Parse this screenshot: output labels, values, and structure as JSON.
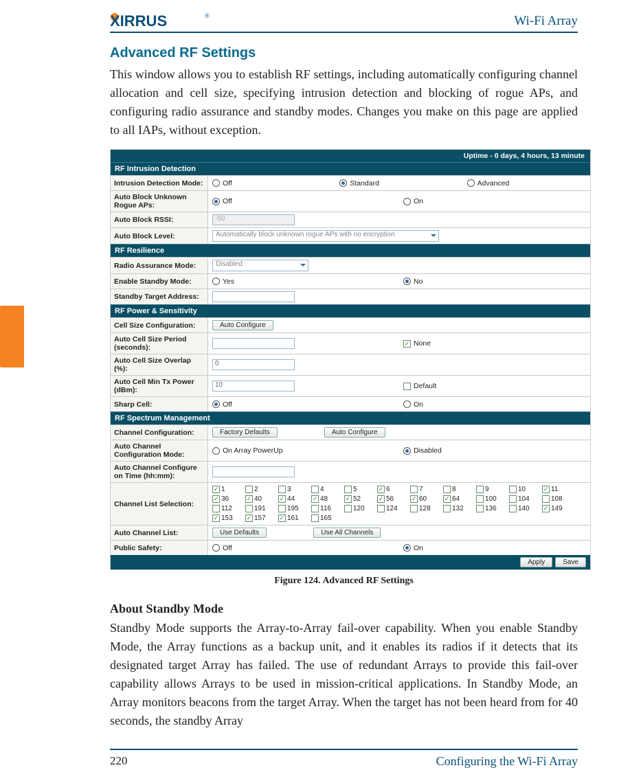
{
  "header": {
    "product": "Wi-Fi Array",
    "logo_text": "XIRRUS"
  },
  "section": {
    "title": "Advanced RF Settings",
    "intro": "This window allows you to establish RF settings, including automatically configuring channel allocation and cell size, specifying intrusion detection and blocking of rogue APs, and configuring radio assurance and standby modes. Changes you make on this page are applied to all IAPs, without exception."
  },
  "screenshot": {
    "uptime": "Uptime - 0 days, 4 hours, 13 minute",
    "groups": {
      "intrusion": "RF Intrusion Detection",
      "resilience": "RF Resilience",
      "power": "RF Power & Sensitivity",
      "spectrum": "RF Spectrum Management"
    },
    "rows": {
      "idm": {
        "label": "Intrusion Detection Mode:",
        "opts": [
          "Off",
          "Standard",
          "Advanced"
        ],
        "sel": "Standard"
      },
      "abu": {
        "label": "Auto Block Unknown Rogue APs:",
        "opts": [
          "Off",
          "On"
        ],
        "sel": "Off"
      },
      "abr": {
        "label": "Auto Block RSSI:",
        "value": "-50"
      },
      "abl": {
        "label": "Auto Block Level:",
        "value": "Automatically block unknown rogue APs with no encryption"
      },
      "ram": {
        "label": "Radio Assurance Mode:",
        "value": "Disabled"
      },
      "esm": {
        "label": "Enable Standby Mode:",
        "opts": [
          "Yes",
          "No"
        ],
        "sel": "No"
      },
      "sta": {
        "label": "Standby Target Address:",
        "value": ""
      },
      "csc": {
        "label": "Cell Size Configuration:",
        "btn": "Auto Configure"
      },
      "acsp": {
        "label": "Auto Cell Size Period (seconds):",
        "value": "",
        "ck": "None"
      },
      "acso": {
        "label": "Auto Cell Size Overlap (%):",
        "value": "0"
      },
      "acmt": {
        "label": "Auto Cell Min Tx Power (dBm):",
        "value": "10",
        "ck": "Default"
      },
      "sharp": {
        "label": "Sharp Cell:",
        "opts": [
          "Off",
          "On"
        ],
        "sel": "Off"
      },
      "ccfg": {
        "label": "Channel Configuration:",
        "btn1": "Factory Defaults",
        "btn2": "Auto Configure"
      },
      "accm": {
        "label": "Auto Channel Configuration Mode:",
        "opts": [
          "On Array PowerUp",
          "Disabled"
        ],
        "sel": "Disabled"
      },
      "acct": {
        "label": "Auto Channel Configure on Time (hh:mm):",
        "value": ""
      },
      "cls": {
        "label": "Channel List Selection:"
      },
      "acl": {
        "label": "Auto Channel List:",
        "btn1": "Use Defaults",
        "btn2": "Use All Channels"
      },
      "ps": {
        "label": "Public Safety:",
        "opts": [
          "Off",
          "On"
        ],
        "sel": "On"
      }
    },
    "channels": [
      {
        "n": "1",
        "c": true
      },
      {
        "n": "2",
        "c": false
      },
      {
        "n": "3",
        "c": false
      },
      {
        "n": "4",
        "c": false
      },
      {
        "n": "5",
        "c": false
      },
      {
        "n": "6",
        "c": true
      },
      {
        "n": "7",
        "c": false
      },
      {
        "n": "8",
        "c": false
      },
      {
        "n": "9",
        "c": false
      },
      {
        "n": "10",
        "c": false
      },
      {
        "n": "11",
        "c": true
      },
      {
        "n": "36",
        "c": true
      },
      {
        "n": "40",
        "c": true
      },
      {
        "n": "44",
        "c": true
      },
      {
        "n": "48",
        "c": true
      },
      {
        "n": "52",
        "c": true
      },
      {
        "n": "56",
        "c": true
      },
      {
        "n": "60",
        "c": true
      },
      {
        "n": "64",
        "c": true
      },
      {
        "n": "100",
        "c": false
      },
      {
        "n": "104",
        "c": false
      },
      {
        "n": "108",
        "c": false
      },
      {
        "n": "112",
        "c": false
      },
      {
        "n": "191",
        "c": false
      },
      {
        "n": "195",
        "c": false
      },
      {
        "n": "116",
        "c": false
      },
      {
        "n": "120",
        "c": false
      },
      {
        "n": "124",
        "c": false
      },
      {
        "n": "128",
        "c": false
      },
      {
        "n": "132",
        "c": false
      },
      {
        "n": "136",
        "c": false
      },
      {
        "n": "140",
        "c": false
      },
      {
        "n": "149",
        "c": true
      },
      {
        "n": "153",
        "c": true
      },
      {
        "n": "157",
        "c": true
      },
      {
        "n": "161",
        "c": true
      },
      {
        "n": "165",
        "c": false
      }
    ],
    "footer": {
      "apply": "Apply",
      "save": "Save"
    }
  },
  "figure_caption": "Figure 124. Advanced RF Settings",
  "sub": {
    "title": "About Standby Mode",
    "body": "Standby Mode supports the Array-to-Array fail-over capability. When you enable Standby Mode, the Array functions as a backup unit, and it enables its radios if it detects that its designated target Array has failed. The use of redundant Arrays to provide this fail-over capability allows Arrays to be used in mission-critical applications. In Standby Mode, an Array monitors beacons from the target Array. When the target has not been heard from for 40 seconds, the standby Array"
  },
  "footer": {
    "page": "220",
    "section": "Configuring the Wi-Fi Array"
  }
}
